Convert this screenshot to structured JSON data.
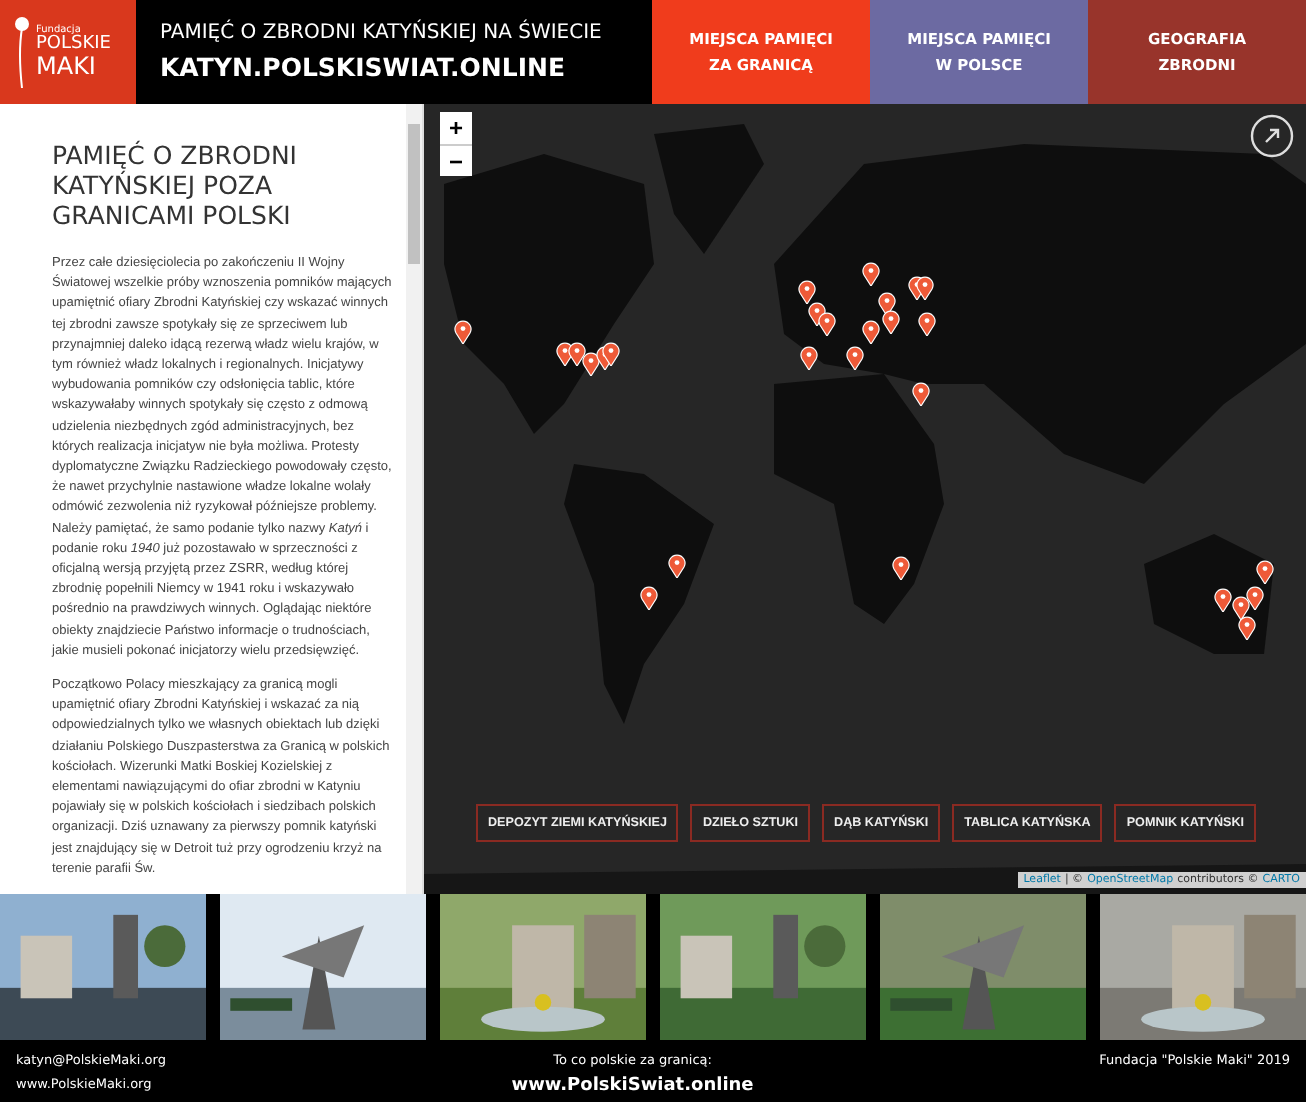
{
  "header": {
    "logo": {
      "small": "Fundacja",
      "line1": "POLSKIE",
      "line2": "MAKI"
    },
    "title": "PAMIĘĆ O ZBRODNI KATYŃSKIEJ NA ŚWIECIE",
    "site": "KATYN.POLSKISWIAT.ONLINE"
  },
  "nav": [
    {
      "lines": [
        "MIEJSCA PAMIĘCI",
        "ZA GRANICĄ"
      ],
      "color": "#f03c1c"
    },
    {
      "lines": [
        "MIEJSCA PAMIĘCI",
        "W POLSCE"
      ],
      "color": "#6c6aa2"
    },
    {
      "lines": [
        "GEOGRAFIA",
        "ZBRODNI"
      ],
      "color": "#98342b"
    }
  ],
  "article": {
    "heading": "PAMIĘĆ O ZBRODNI KATYŃSKIEJ POZA GRANICAMI POLSKI",
    "paragraphs": [
      "Przez całe dziesięciolecia po zakończeniu II Wojny Światowej wszelkie próby wznoszenia pomników mających upamiętnić ofiary Zbrodni Katyńskiej czy wskazać winnych tej zbrodni zawsze spotykały się ze sprzeciwem lub przynajmniej daleko idącą rezerwą władz wielu krajów, w tym również władz lokalnych i regionalnych. Inicjatywy wybudowania pomników czy odsłonięcia tablic, które wskazywałaby winnych spotykały się często z odmową udzielenia niezbędnych zgód administracyjnych, bez których realizacja inicjatyw nie była możliwa. Protesty dyplomatyczne Związku Radzieckiego powodowały często, że nawet przychylnie nastawione władze lokalne wolały odmówić zezwolenia niż ryzykował późniejsze problemy. Należy pamiętać, że samo podanie tylko nazwy *Katyń* i podanie roku *1940* już pozostawało w sprzeczności z oficjalną wersją przyjętą przez ZSRR, według której zbrodnię popełnili Niemcy w 1941 roku i wskazywało pośrednio na prawdziwych winnych. Oglądając niektóre obiekty znajdziecie Państwo informacje o trudnościach, jakie musieli pokonać inicjatorzy wielu przedsięwzięć.",
      "Początkowo Polacy mieszkający za granicą mogli upamiętnić ofiary Zbrodni Katyńskiej i wskazać za nią odpowiedzialnych tylko we własnych obiektach lub dzięki działaniu Polskiego Duszpasterstwa za Granicą w polskich kościołach. Wizerunki Matki Boskiej Kozielskiej z elementami nawiązującymi do ofiar zbrodni w Katyniu pojawiały się w polskich kościołach i siedzibach polskich organizacji. Dziś uznawany za pierwszy pomnik katyński jest znajdujący się w Detroit tuż przy ogrodzeniu krzyż na terenie parafii Św."
    ]
  },
  "map": {
    "zoom_in": "+",
    "zoom_out": "−",
    "filters": [
      "DEPOZYT ZIEMI KATYŃSKIEJ",
      "DZIEŁO SZTUKI",
      "DĄB KATYŃSKI",
      "TABLICA KATYŃSKA",
      "POMNIK KATYŃSKI"
    ],
    "attribution": [
      {
        "kind": "link",
        "text": "Leaflet"
      },
      {
        "kind": "text",
        "text": "| ©"
      },
      {
        "kind": "link",
        "text": "OpenStreetMap"
      },
      {
        "kind": "text",
        "text": "contributors ©"
      },
      {
        "kind": "link",
        "text": "CARTO"
      }
    ]
  },
  "footer": {
    "email": "katyn@PolskieMaki.org",
    "website": "www.PolskieMaki.org",
    "tagline": "To co polskie za granicą:",
    "portal": "www.PolskiSwiat.online",
    "copyright": "Fundacja \"Polskie Maki\" 2019"
  }
}
